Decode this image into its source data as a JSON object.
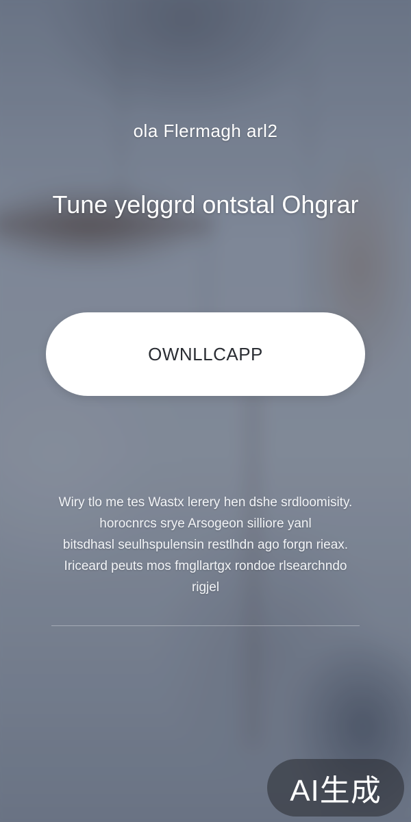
{
  "brand": {
    "title": "ola Flermagh arl2"
  },
  "hero": {
    "headline": "Tune yelggrd ontstal Ohgrar"
  },
  "cta": {
    "label": "OWNLLCAPP"
  },
  "description": {
    "lines": [
      "Wiry tlo me tes Wastx lerery hen dshe srdloomisity.",
      "horocnrcs srye Arsogeon silliore yanl",
      "bitsdhasl seulhspulensin restlhdn ago forgn rieax.",
      "Iriceard peuts mos fmgllartgx rondoe rlsearchndo",
      "rigjel"
    ]
  },
  "watermark": {
    "label": "AI生成"
  },
  "colors": {
    "background": "#7a8596",
    "button_fill": "#ffffff",
    "button_text": "#2a2d33",
    "text": "#ffffff"
  }
}
